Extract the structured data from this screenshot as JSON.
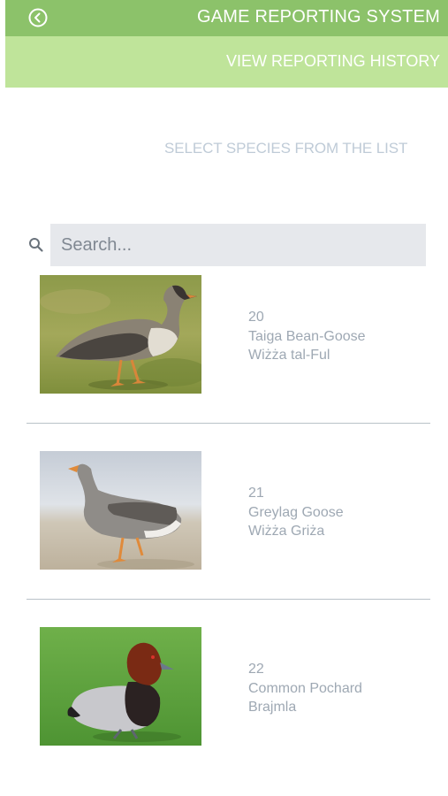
{
  "header": {
    "title": "GAME REPORTING SYSTEM",
    "back_icon": "back-arrow-circle-icon"
  },
  "subbar": {
    "history_label": "VIEW REPORTING HISTORY"
  },
  "prompt": "SELECT SPECIES FROM THE LIST",
  "search": {
    "placeholder": "Search...",
    "value": "",
    "icon": "search-icon"
  },
  "species": [
    {
      "number": "20",
      "english_name": "Taiga Bean-Goose",
      "maltese_name": "Wiżża tal-Ful",
      "image": "taiga-bean-goose-photo"
    },
    {
      "number": "21",
      "english_name": "Greylag Goose",
      "maltese_name": "Wiżża Griża",
      "image": "greylag-goose-photo"
    },
    {
      "number": "22",
      "english_name": "Common Pochard",
      "maltese_name": "Brajmla",
      "image": "common-pochard-photo"
    }
  ],
  "colors": {
    "header_bg": "#8cc26a",
    "subbar_bg": "#bfe49a",
    "search_bg": "#e6e8ec",
    "item_text": "#9ea8b3",
    "prompt_text": "#bfcbd7"
  }
}
